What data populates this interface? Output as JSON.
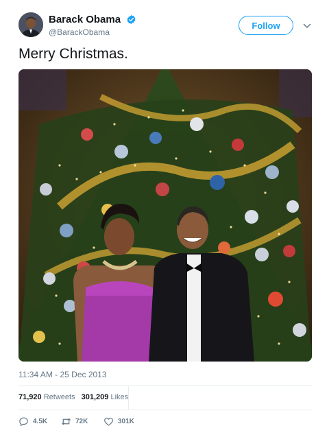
{
  "author": {
    "display_name": "Barack Obama",
    "handle": "@BarackObama",
    "verified": true,
    "avatar_icon": "profile-photo",
    "follow_label": "Follow",
    "menu_icon": "chevron-down-icon"
  },
  "tweet": {
    "text": "Merry Christmas.",
    "photo_icon": "christmas-tree-photo",
    "timestamp": "11:34 AM - 25 Dec 2013"
  },
  "stats": {
    "retweets_count": "71,920",
    "retweets_label": "Retweets",
    "likes_count": "301,209",
    "likes_label": "Likes"
  },
  "actions": {
    "reply_count": "4.5K",
    "retweet_count": "72K",
    "like_count": "301K"
  },
  "colors": {
    "accent": "#1da1f2",
    "muted": "#657786",
    "text": "#14171a",
    "divider": "#e6ecf0"
  }
}
